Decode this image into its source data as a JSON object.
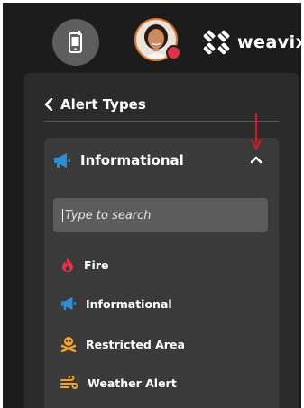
{
  "header": {
    "phone_icon": "mobile-phone-icon",
    "brand_name": "weavix",
    "colors": {
      "background": "#1c1c1c",
      "avatar_ring": "#e27a2b",
      "status_dot": "#e0334a"
    }
  },
  "panel": {
    "back_icon": "chevron-left-icon",
    "title": "Alert Types"
  },
  "dropdown": {
    "selected_icon": "megaphone-icon",
    "selected_label": "Informational",
    "expanded": true,
    "search": {
      "placeholder": "Type to search",
      "value": ""
    },
    "items": [
      {
        "label": "Fire",
        "icon": "fire-icon",
        "color": "#e8334a"
      },
      {
        "label": "Informational",
        "icon": "megaphone-icon",
        "color": "#2d8ed8"
      },
      {
        "label": "Restricted Area",
        "icon": "skull-crossbones-icon",
        "color": "#f2a42a"
      },
      {
        "label": "Weather Alert",
        "icon": "wind-icon",
        "color": "#f2a42a"
      }
    ]
  },
  "annotation": {
    "arrow_color": "#e0151f"
  }
}
